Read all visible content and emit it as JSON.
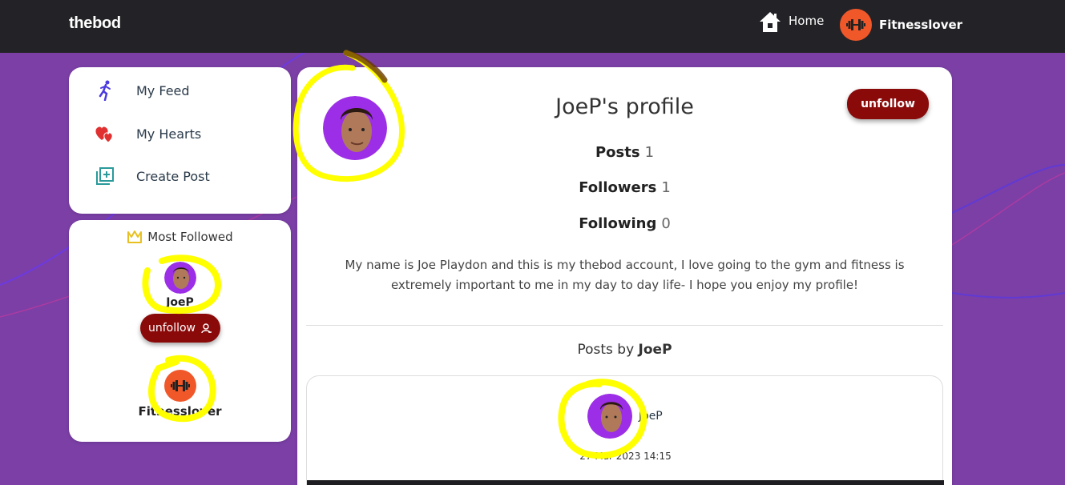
{
  "navbar": {
    "brand": "thebod",
    "home_label": "Home",
    "user_name": "Fitnesslover",
    "home_icon": "house-icon",
    "user_icon": "dumbbell-icon"
  },
  "sidebar": {
    "items": [
      {
        "label": "My Feed",
        "icon": "running-person-icon"
      },
      {
        "label": "My Hearts",
        "icon": "hearts-icon"
      },
      {
        "label": "Create Post",
        "icon": "add-post-icon"
      }
    ]
  },
  "most_followed": {
    "title": "Most Followed",
    "icon": "crown-icon",
    "users": [
      {
        "name": "JoeP",
        "button_label": "unfollow"
      },
      {
        "name": "Fitnesslover"
      }
    ]
  },
  "profile": {
    "title": "JoeP's profile",
    "unfollow_label": "unfollow",
    "stats": [
      {
        "label": "Posts",
        "value": "1"
      },
      {
        "label": "Followers",
        "value": "1"
      },
      {
        "label": "Following",
        "value": "0"
      }
    ],
    "bio": "My name is Joe Playdon and this is my thebod account, I love going to the gym and fitness is extremely important to me in my day to day life- I hope you enjoy my profile!",
    "posts_by_prefix": "Posts by",
    "posts_by_name": "JoeP"
  },
  "post": {
    "author": "JoeP",
    "date": "27 Mar 2023 14:15"
  },
  "colors": {
    "navbar": "#232327",
    "background": "#7b3fa6",
    "unfollow": "#8a0a0a",
    "avatar_orange": "#f0582a",
    "avatar_purple": "#9b2ee6",
    "highlight": "#ffff00"
  }
}
